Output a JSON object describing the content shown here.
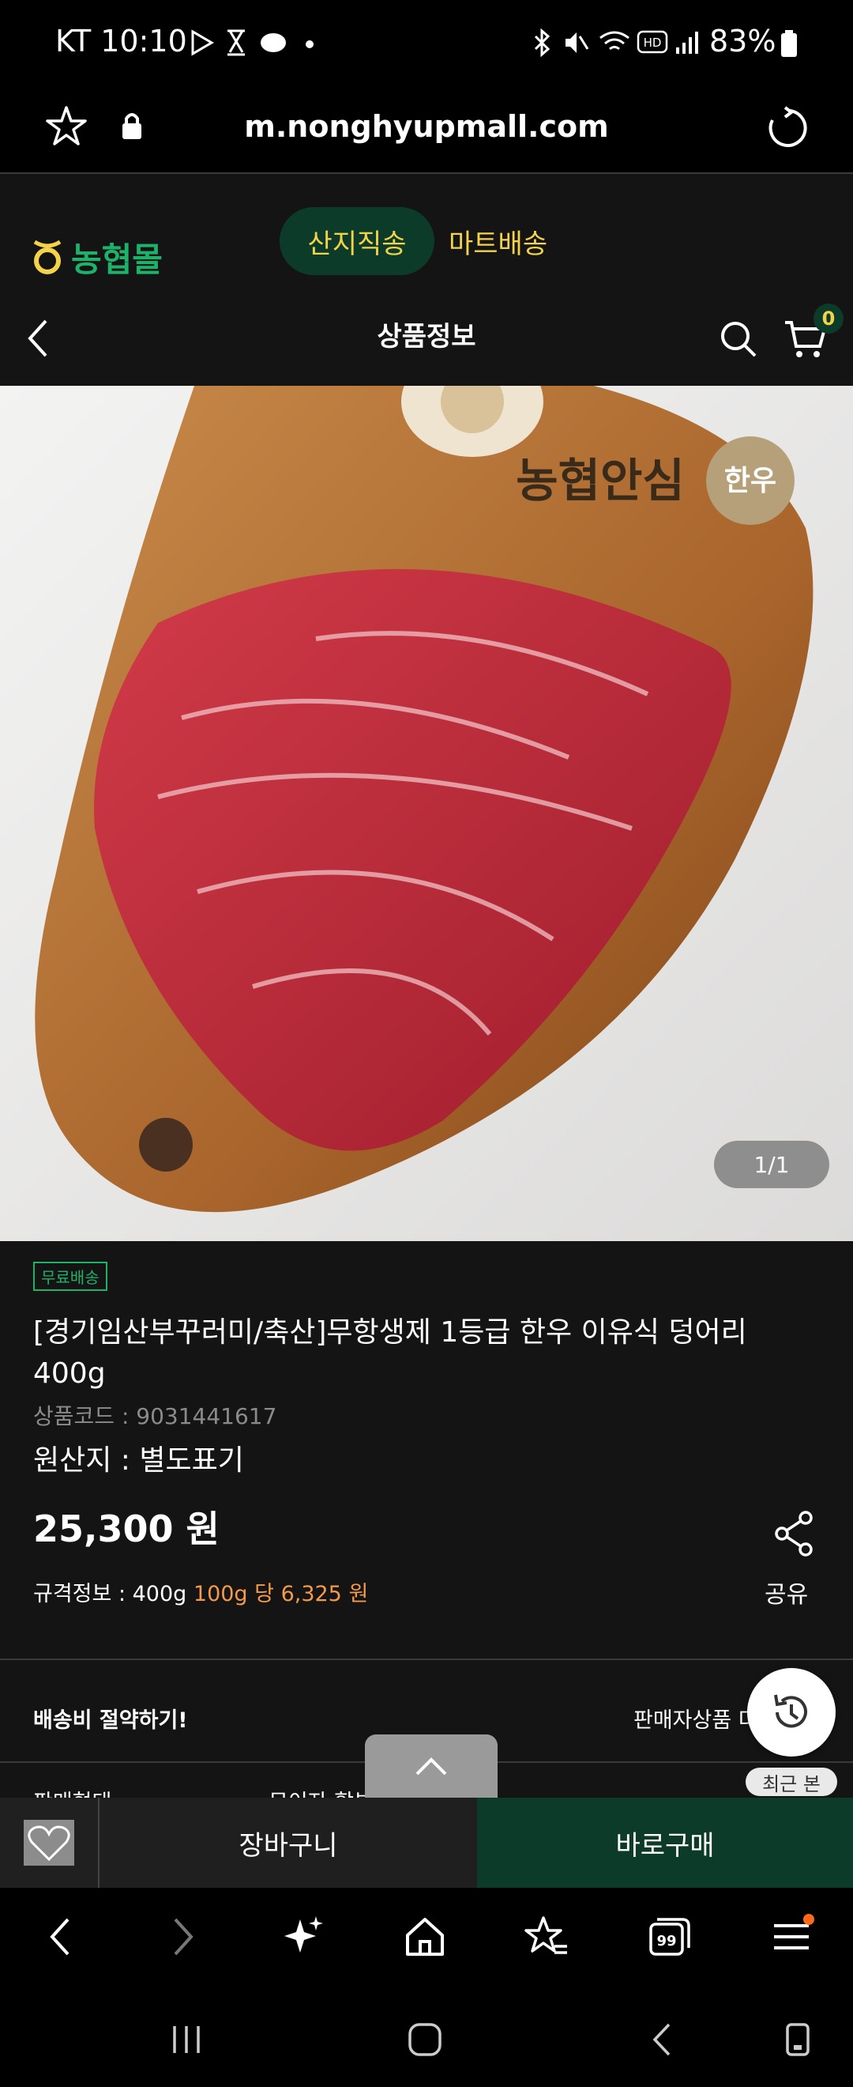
{
  "status_bar": {
    "carrier_time": "KT 10:10",
    "battery": "83%"
  },
  "browser": {
    "url": "m.nonghyupmall.com"
  },
  "site": {
    "logo_text": "농협몰",
    "tabs": [
      {
        "label": "산지직송",
        "active": true
      },
      {
        "label": "마트배송",
        "active": false
      }
    ],
    "page_title": "상품정보",
    "cart_count": "0"
  },
  "product": {
    "image_watermark": "농협안심한우",
    "pager": "1/1",
    "badge": "무료배송",
    "title": "[경기임산부꾸러미/축산]무항생제 1등급 한우 이유식 덩어리 400g",
    "code": "상품코드 : 9031441617",
    "origin": "원산지 : 별도표기",
    "price": "25,300 원",
    "spec_label": "규격정보 : 400g",
    "spec_unit_price": "100g 당  6,325 원",
    "share_label": "공유"
  },
  "shipping": {
    "left_label": "배송비 절약하기!",
    "right_label": "판매자상품 더보기",
    "partial_left": "판매형태",
    "partial_mid": "무이자 할부",
    "recent_label": "최근 본"
  },
  "actions": {
    "cart_label": "장바구니",
    "buy_label": "바로구매"
  },
  "browser_toolbar": {
    "tab_count": "99"
  },
  "colors": {
    "accent_green": "#1db16a",
    "dark_green": "#0d3b2a",
    "tab_yellow": "#f3d34a",
    "unit_price_orange": "#f39a4b"
  }
}
